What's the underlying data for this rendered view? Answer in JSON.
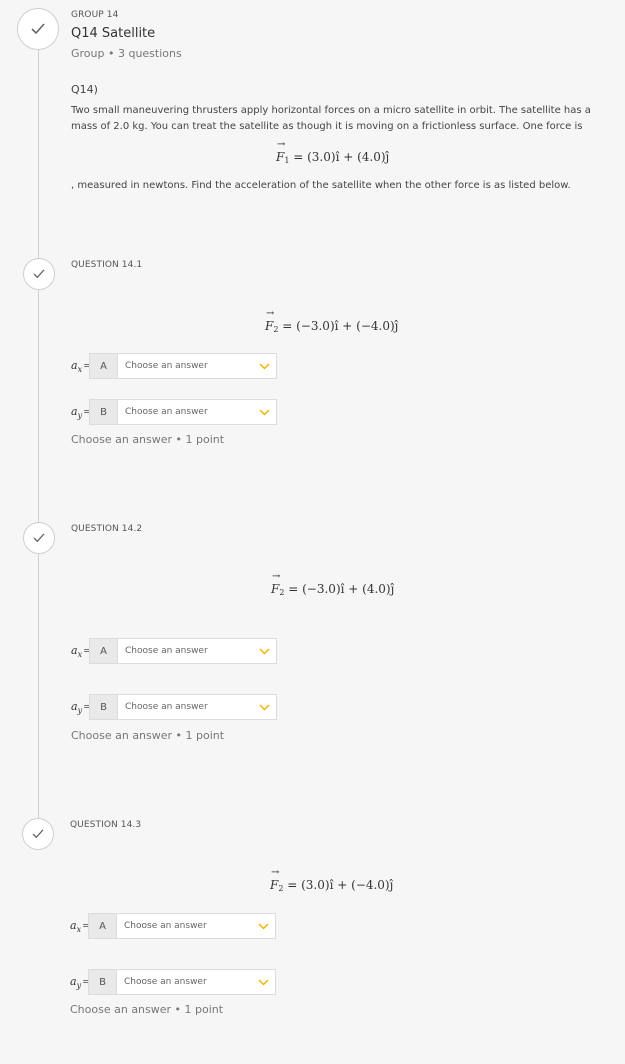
{
  "group": {
    "kicker": "GROUP 14",
    "title": "Q14 Satellite",
    "meta": "Group • 3 questions",
    "qnum": "Q14)",
    "prompt": "Two small maneuvering thrusters apply horizontal forces on a micro satellite in orbit. The satellite has a mass of 2.0 kg. You can treat the satellite as though it is moving on a frictionless surface. One force is",
    "formula_tail": "= (3.0)î + (4.0)ĵ",
    "prompt_after": ", measured in newtons. Find the acceleration of the satellite when the other force is as listed below."
  },
  "questions": [
    {
      "label": "QUESTION 14.1",
      "formula_tail": "= (−3.0)î + (−4.0)ĵ",
      "rows": [
        {
          "var": "a",
          "sub": "x",
          "eq": "=",
          "letter": "A",
          "placeholder": "Choose an answer"
        },
        {
          "var": "a",
          "sub": "y",
          "eq": "=",
          "letter": "B",
          "placeholder": "Choose an answer"
        }
      ],
      "points": "Choose an answer • 1 point"
    },
    {
      "label": "QUESTION 14.2",
      "formula_tail": "= (−3.0)î + (4.0)ĵ",
      "rows": [
        {
          "var": "a",
          "sub": "x",
          "eq": "=",
          "letter": "A",
          "placeholder": "Choose an answer"
        },
        {
          "var": "a",
          "sub": "y",
          "eq": "=",
          "letter": "B",
          "placeholder": "Choose an answer"
        }
      ],
      "points": "Choose an answer • 1 point"
    },
    {
      "label": "QUESTION 14.3",
      "formula_tail": "= (3.0)î + (−4.0)ĵ",
      "rows": [
        {
          "var": "a",
          "sub": "x",
          "eq": "=",
          "letter": "A",
          "placeholder": "Choose an answer"
        },
        {
          "var": "a",
          "sub": "y",
          "eq": "=",
          "letter": "B",
          "placeholder": "Choose an answer"
        }
      ],
      "points": "Choose an answer • 1 point"
    }
  ],
  "math": {
    "force_symbol": "F",
    "force_sub_1": "1",
    "force_sub_2": "2"
  },
  "icons": {
    "check": "checkmark-icon",
    "chevron": "chevron-down-icon"
  },
  "colors": {
    "chevron": "#f0b400",
    "check": "#666666",
    "timeline": "#cfcfcf"
  }
}
